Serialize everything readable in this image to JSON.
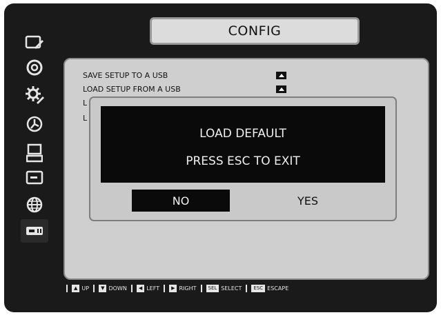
{
  "window": {
    "title": "CONFIG"
  },
  "sidebar": {
    "items": [
      {
        "icon": "camera-edit-icon"
      },
      {
        "icon": "disc-icon"
      },
      {
        "icon": "gear-icon"
      },
      {
        "icon": "clock-icon"
      },
      {
        "icon": "monitor-icon"
      },
      {
        "icon": "display-icon"
      },
      {
        "icon": "network-globe-icon"
      },
      {
        "icon": "storage-device-icon"
      }
    ]
  },
  "menu": {
    "items": [
      {
        "label": "SAVE SETUP TO A USB"
      },
      {
        "label": "LOAD SETUP FROM A USB"
      },
      {
        "label": "L"
      },
      {
        "label": "L"
      }
    ]
  },
  "dialog": {
    "line1": "LOAD DEFAULT",
    "line2": "PRESS ESC TO EXIT",
    "no_label": "NO",
    "yes_label": "YES",
    "selected": "NO"
  },
  "footer": {
    "hints": [
      {
        "key": "▲",
        "label": "UP"
      },
      {
        "key": "▼",
        "label": "DOWN"
      },
      {
        "key": "◀",
        "label": "LEFT"
      },
      {
        "key": "▶",
        "label": "RIGHT"
      },
      {
        "key": "SEL",
        "label": "SELECT"
      },
      {
        "key": "ESC",
        "label": "ESCAPE"
      }
    ]
  },
  "colors": {
    "background": "#1a1a1a",
    "panel": "#cfcfcf",
    "selected": "#0a0a0a",
    "text_light": "#f0f0f0"
  }
}
